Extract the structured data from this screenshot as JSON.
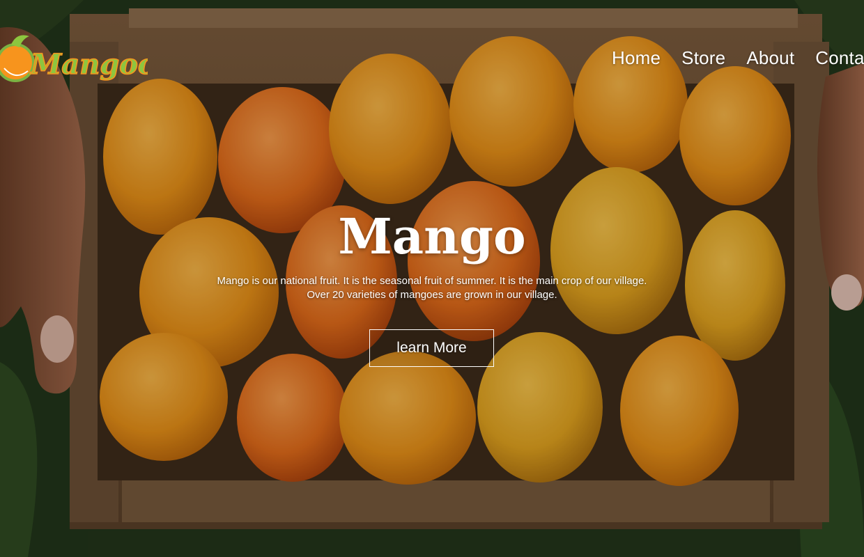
{
  "brand": {
    "logo_text": "Mangood",
    "colors": {
      "logo_fill": "#8dc63f",
      "logo_outline": "#f7941d",
      "mango": "#f29a1e",
      "text": "#ffffff"
    }
  },
  "nav": {
    "items": [
      {
        "label": "Home"
      },
      {
        "label": "Store"
      },
      {
        "label": "About"
      },
      {
        "label": "Conta"
      }
    ]
  },
  "hero": {
    "title": "Mango",
    "description_line1": "Mango is our national fruit. It is the seasonal fruit of summer. It is the main crop of our village.",
    "description_line2": "Over 20 varieties of mangoes are grown in our village.",
    "button_label": "learn More",
    "background_icon": "mango-crate-photo"
  }
}
